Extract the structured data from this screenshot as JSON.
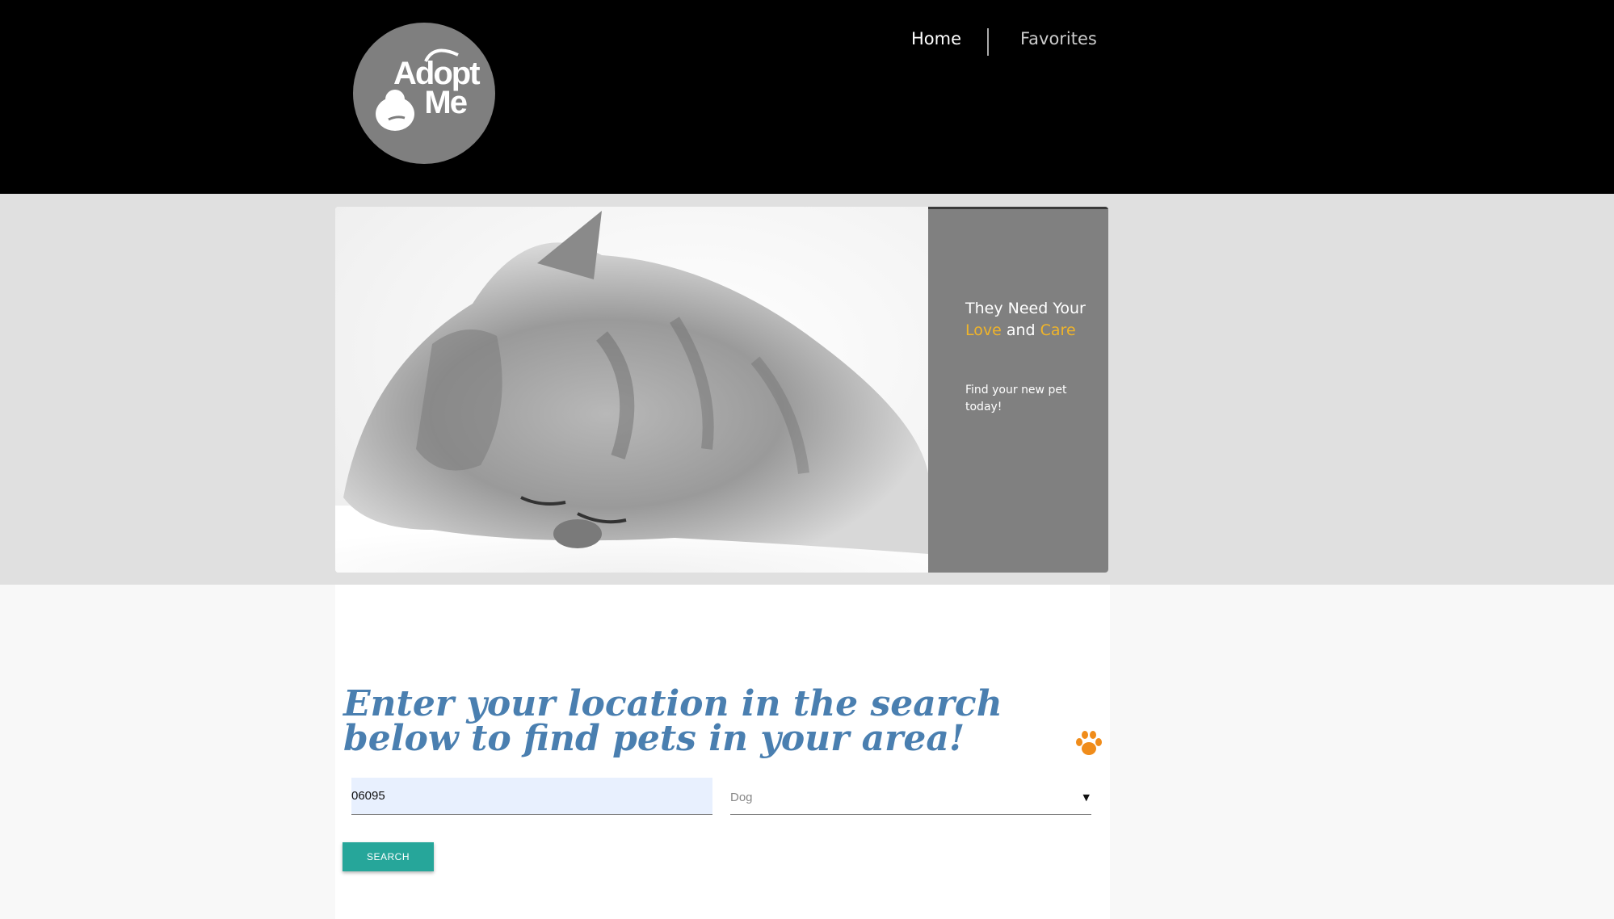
{
  "header": {
    "logo_text_line1": "Adopt",
    "logo_text_line2": "Me",
    "nav": {
      "home": "Home",
      "favorites": "Favorites"
    }
  },
  "hero": {
    "tagline_part1": "They Need Your ",
    "tagline_love": "Love",
    "tagline_and": " and ",
    "tagline_care": "Care",
    "subline": "Find your new pet today!",
    "accent_color": "#f0b429"
  },
  "search": {
    "headline": "Enter your location in the search below to find pets in your area!",
    "zip_value": "06095",
    "pet_type": "Dog",
    "button_label": "SEARCH",
    "button_color": "#26a69a"
  },
  "colors": {
    "header_bg": "#000000",
    "band_bg": "#e0e0e0",
    "headline": "#4a7fb0",
    "paw": "#f08c1a"
  }
}
